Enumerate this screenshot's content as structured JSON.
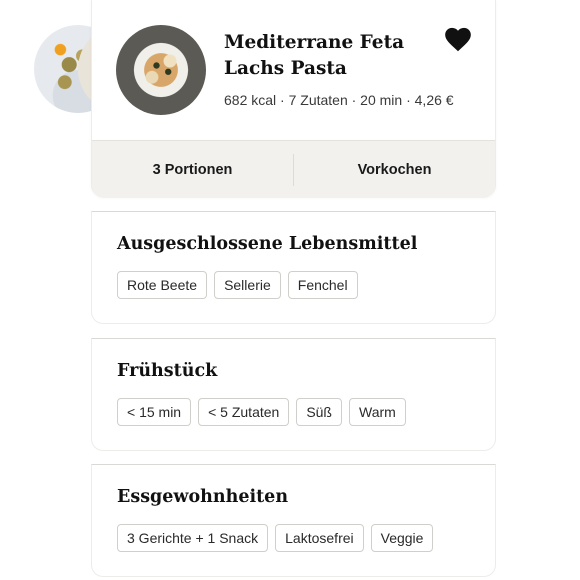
{
  "recipe": {
    "title": "Mediterrane Feta Lachs Pasta",
    "meta": "682 kcal · 7 Zutaten · 20 min · 4,26 €",
    "favorite_icon": "heart-icon",
    "actions": {
      "portions": "3 Portionen",
      "meal_prep": "Vorkochen"
    }
  },
  "sections": [
    {
      "title": "Ausgeschlossene Lebensmittel",
      "chips": [
        "Rote Beete",
        "Sellerie",
        "Fenchel"
      ]
    },
    {
      "title": "Frühstück",
      "chips": [
        "< 15 min",
        "< 5 Zutaten",
        "Süß",
        "Warm"
      ]
    },
    {
      "title": "Essgewohnheiten",
      "chips": [
        "3 Gerichte + 1 Snack",
        "Laktosefrei",
        "Veggie"
      ]
    }
  ],
  "colors": {
    "action_bar": "#f2f1ee",
    "chip_border": "#cfcfcb",
    "text": "#1a1a1a"
  }
}
